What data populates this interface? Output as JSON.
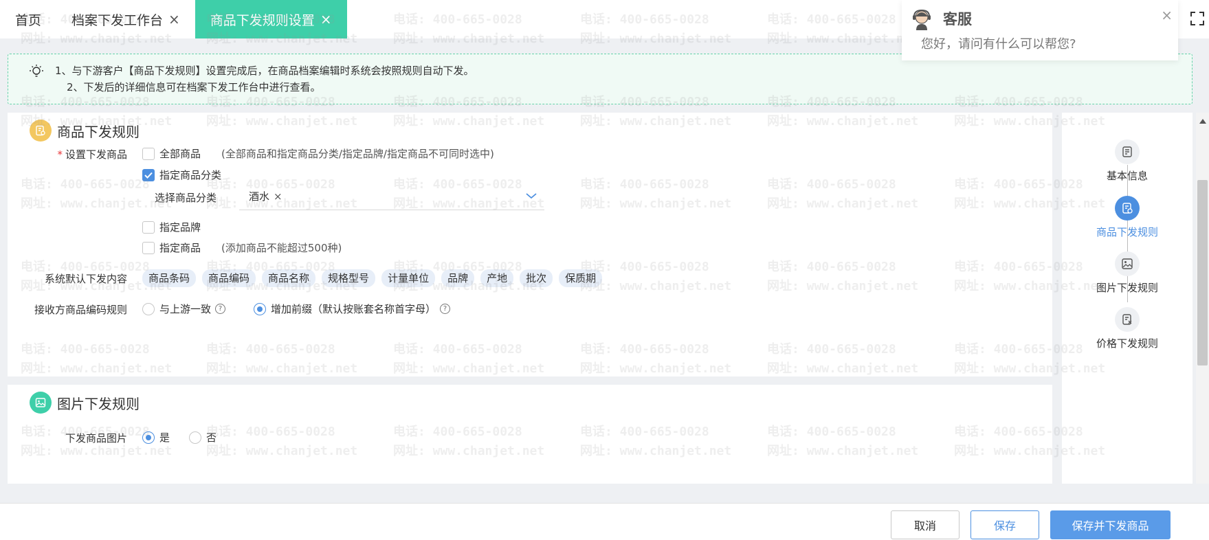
{
  "tabs": [
    {
      "label": "首页",
      "closable": false
    },
    {
      "label": "档案下发工作台",
      "closable": true
    },
    {
      "label": "商品下发规则设置",
      "closable": true,
      "active": true
    }
  ],
  "notice": {
    "line1": "1、与下游客户【商品下发规则】设置完成后，在商品档案编辑时系统会按照规则自动下发。",
    "line2": "2、下发后的详细信息可在档案下发工作台中进行查看。"
  },
  "section1": {
    "title": "商品下发规则",
    "set_label": "设置下发商品",
    "required_mark": "*",
    "all_goods": {
      "label": "全部商品",
      "hint": "(全部商品和指定商品分类/指定品牌/指定商品不可同时选中)",
      "checked": false
    },
    "by_category": {
      "label": "指定商品分类",
      "checked": true
    },
    "category_select_label": "选择商品分类",
    "category_tag": "酒水",
    "by_brand": {
      "label": "指定品牌",
      "checked": false
    },
    "by_goods": {
      "label": "指定商品",
      "hint": "(添加商品不能超过500种)",
      "checked": false
    },
    "default_content_label": "系统默认下发内容",
    "default_content": [
      "商品条码",
      "商品编码",
      "商品名称",
      "规格型号",
      "计量单位",
      "品牌",
      "产地",
      "批次",
      "保质期"
    ],
    "code_rule_label": "接收方商品编码规则",
    "code_rule_options": [
      {
        "label": "与上游一致",
        "selected": false
      },
      {
        "label": "增加前缀（默认按账套名称首字母）",
        "selected": true
      }
    ]
  },
  "section2": {
    "title": "图片下发规则",
    "image_label": "下发商品图片",
    "options": [
      {
        "label": "是",
        "selected": true
      },
      {
        "label": "否",
        "selected": false
      }
    ]
  },
  "anchors": [
    {
      "label": "基本信息",
      "icon": "doc-icon",
      "active": false
    },
    {
      "label": "商品下发规则",
      "icon": "rule-icon",
      "active": true
    },
    {
      "label": "图片下发规则",
      "icon": "image-icon",
      "active": false
    },
    {
      "label": "价格下发规则",
      "icon": "price-icon",
      "active": false
    }
  ],
  "cs_popup": {
    "title": "客服",
    "message": "您好，请问有什么可以帮您?",
    "close": "×"
  },
  "footer": {
    "cancel": "取消",
    "save": "保存",
    "save_and_send": "保存并下发商品"
  },
  "watermark": {
    "phone": "电话: 400-665-0028",
    "site": "网址: www.chanjet.net"
  },
  "colors": {
    "accent_green": "#3ecfa9",
    "primary_blue": "#4c8fe0",
    "section_yellow": "#f3c760"
  }
}
